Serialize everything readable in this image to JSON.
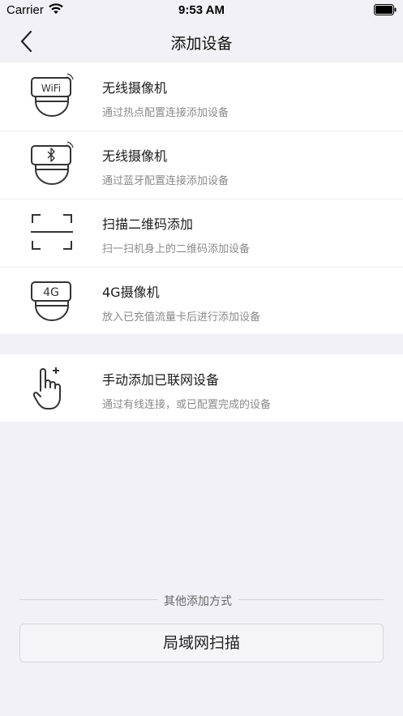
{
  "status_bar": {
    "carrier": "Carrier",
    "time": "9:53 AM"
  },
  "nav": {
    "title": "添加设备",
    "back_icon": "chevron-left-icon"
  },
  "devices": [
    {
      "icon": "wifi-camera-icon",
      "icon_text": "WiFi",
      "title": "无线摄像机",
      "subtitle": "通过热点配置连接添加设备"
    },
    {
      "icon": "bluetooth-camera-icon",
      "title": "无线摄像机",
      "subtitle": "通过蓝牙配置连接添加设备"
    },
    {
      "icon": "scan-qr-icon",
      "title": "扫描二维码添加",
      "subtitle": "扫一扫机身上的二维码添加设备"
    },
    {
      "icon": "4g-camera-icon",
      "icon_text": "4G",
      "title": "4G摄像机",
      "subtitle": "放入已充值流量卡后进行添加设备"
    }
  ],
  "manual": {
    "icon": "hand-add-icon",
    "title": "手动添加已联网设备",
    "subtitle": "通过有线连接，或已配置完成的设备"
  },
  "other": {
    "label": "其他添加方式",
    "lan_button": "局域网扫描"
  },
  "colors": {
    "background": "#f2f2f6",
    "card": "#ffffff",
    "icon_stroke": "#333333"
  }
}
